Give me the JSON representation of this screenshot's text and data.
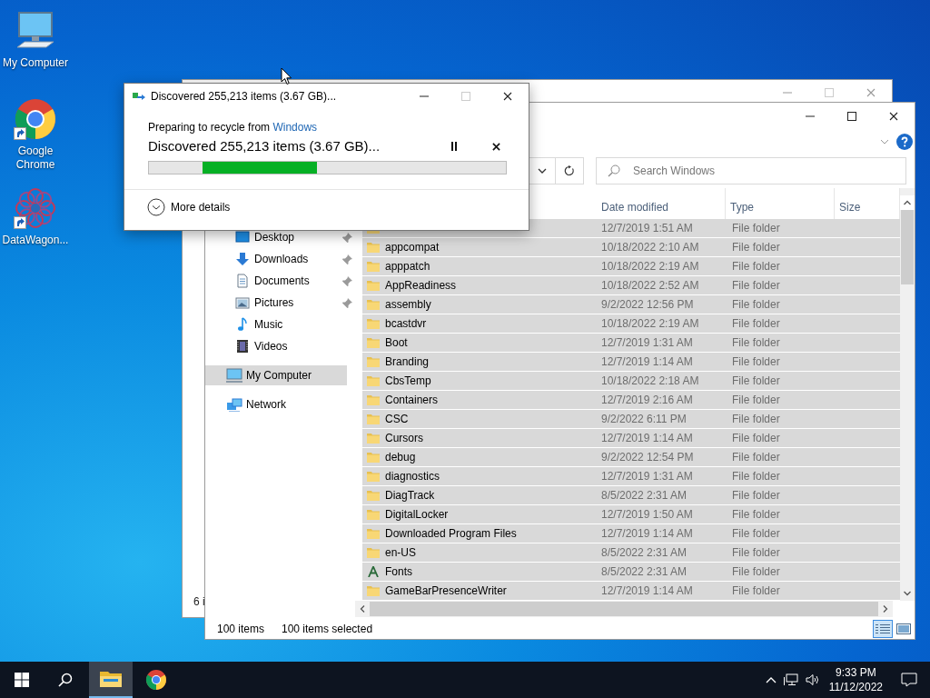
{
  "desktop_icons": [
    {
      "label": "My Computer",
      "kind": "computer",
      "shortcut": false
    },
    {
      "label": "Google Chrome",
      "kind": "chrome",
      "shortcut": true
    },
    {
      "label": "DataWagon...",
      "kind": "app",
      "shortcut": true
    }
  ],
  "background_window": {
    "status": "6 i"
  },
  "explorer": {
    "search": {
      "placeholder": "Search Windows"
    },
    "columns": [
      "Date modified",
      "Type",
      "Size"
    ],
    "quick_access": [
      {
        "label": "Desktop",
        "kind": "desktop",
        "pinned": true,
        "selected": false
      },
      {
        "label": "Downloads",
        "kind": "downloads",
        "pinned": true,
        "selected": false
      },
      {
        "label": "Documents",
        "kind": "documents",
        "pinned": true,
        "selected": false
      },
      {
        "label": "Pictures",
        "kind": "pictures",
        "pinned": true,
        "selected": false
      },
      {
        "label": "Music",
        "kind": "music",
        "pinned": false,
        "selected": false
      },
      {
        "label": "Videos",
        "kind": "videos",
        "pinned": false,
        "selected": false
      }
    ],
    "places": [
      {
        "label": "My Computer",
        "kind": "computer",
        "selected": true
      },
      {
        "label": "Network",
        "kind": "network",
        "selected": false
      }
    ],
    "rows": [
      {
        "kind": "folder",
        "date": "12/7/2019 1:51 AM",
        "type": "File folder",
        "selected": true
      },
      {
        "name": "appcompat",
        "kind": "folder",
        "date": "10/18/2022 2:10 AM",
        "type": "File folder",
        "selected": true
      },
      {
        "name": "apppatch",
        "kind": "folder",
        "date": "10/18/2022 2:19 AM",
        "type": "File folder",
        "selected": true
      },
      {
        "name": "AppReadiness",
        "kind": "folder",
        "date": "10/18/2022 2:52 AM",
        "type": "File folder",
        "selected": true
      },
      {
        "name": "assembly",
        "kind": "folder",
        "date": "9/2/2022 12:56 PM",
        "type": "File folder",
        "selected": true
      },
      {
        "name": "bcastdvr",
        "kind": "folder",
        "date": "10/18/2022 2:19 AM",
        "type": "File folder",
        "selected": true
      },
      {
        "name": "Boot",
        "kind": "folder",
        "date": "12/7/2019 1:31 AM",
        "type": "File folder",
        "selected": true
      },
      {
        "name": "Branding",
        "kind": "folder",
        "date": "12/7/2019 1:14 AM",
        "type": "File folder",
        "selected": true
      },
      {
        "name": "CbsTemp",
        "kind": "folder",
        "date": "10/18/2022 2:18 AM",
        "type": "File folder",
        "selected": true
      },
      {
        "name": "Containers",
        "kind": "folder",
        "date": "12/7/2019 2:16 AM",
        "type": "File folder",
        "selected": true
      },
      {
        "name": "CSC",
        "kind": "folder",
        "date": "9/2/2022 6:11 PM",
        "type": "File folder",
        "selected": true
      },
      {
        "name": "Cursors",
        "kind": "folder",
        "date": "12/7/2019 1:14 AM",
        "type": "File folder",
        "selected": true
      },
      {
        "name": "debug",
        "kind": "folder",
        "date": "9/2/2022 12:54 PM",
        "type": "File folder",
        "selected": true
      },
      {
        "name": "diagnostics",
        "kind": "folder",
        "date": "12/7/2019 1:31 AM",
        "type": "File folder",
        "selected": true
      },
      {
        "name": "DiagTrack",
        "kind": "folder",
        "date": "8/5/2022 2:31 AM",
        "type": "File folder",
        "selected": true
      },
      {
        "name": "DigitalLocker",
        "kind": "folder",
        "date": "12/7/2019 1:50 AM",
        "type": "File folder",
        "selected": true
      },
      {
        "name": "Downloaded Program Files",
        "kind": "folder",
        "date": "12/7/2019 1:14 AM",
        "type": "File folder",
        "selected": true
      },
      {
        "name": "en-US",
        "kind": "folder",
        "date": "8/5/2022 2:31 AM",
        "type": "File folder",
        "selected": true
      },
      {
        "name": "Fonts",
        "kind": "font",
        "date": "8/5/2022 2:31 AM",
        "type": "File folder",
        "selected": true
      },
      {
        "name": "GameBarPresenceWriter",
        "kind": "folder",
        "date": "12/7/2019 1:14 AM",
        "type": "File folder",
        "selected": true
      }
    ],
    "status_bar": {
      "count": "100 items",
      "selection": "100 items selected"
    },
    "views": [
      {
        "kind": "details",
        "selected": true
      },
      {
        "kind": "preview",
        "selected": false
      }
    ]
  },
  "dialog": {
    "title": "Discovered 255,213 items (3.67 GB)...",
    "source_prefix": "Preparing to recycle from",
    "source_link": "Windows",
    "status": "Discovered 255,213 items (3.67 GB)...",
    "level": 0.32,
    "more": "More details"
  },
  "taskbar": {
    "apps": [
      {
        "kind": "explorer",
        "active": true
      },
      {
        "kind": "chrome",
        "active": false
      }
    ],
    "time": "9:33 PM",
    "date": "11/12/2022"
  }
}
